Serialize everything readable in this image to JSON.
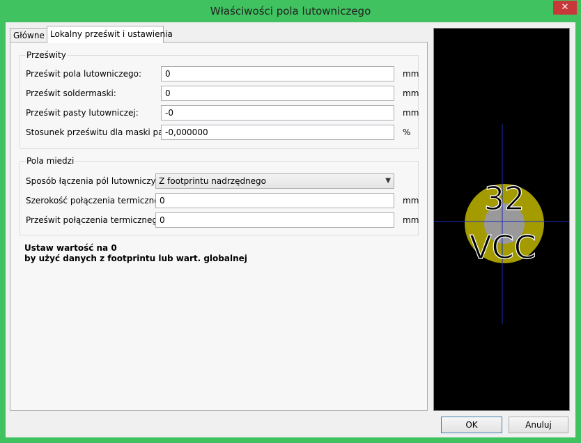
{
  "window": {
    "title": "Właściwości pola lutowniczego",
    "close_symbol": "✕"
  },
  "tabs": [
    {
      "label": "Główne"
    },
    {
      "label": "Lokalny prześwit i ustawienia"
    }
  ],
  "clearances": {
    "title": "Prześwity",
    "pad_clearance": {
      "label": "Prześwit pola lutowniczego:",
      "value": "0",
      "unit": "mm"
    },
    "soldermask_clearance": {
      "label": "Prześwit soldermaski:",
      "value": "0",
      "unit": "mm"
    },
    "paste_clearance": {
      "label": "Prześwit pasty lutowniczej:",
      "value": "-0",
      "unit": "mm"
    },
    "paste_ratio": {
      "label": "Stosunek prześwitu dla maski pasty:",
      "value": "-0,000000",
      "unit": "%"
    }
  },
  "copper_zones": {
    "title": "Pola miedzi",
    "connection": {
      "label": "Sposób łączenia pól lutowniczych:",
      "value": "Z footprintu nadrzędnego"
    },
    "thermal_width": {
      "label": "Szerokość połączenia termicznego",
      "value": "0",
      "unit": "mm"
    },
    "thermal_gap": {
      "label": "Prześwit połączenia termicznego:",
      "value": "0",
      "unit": "mm"
    }
  },
  "note": {
    "line1": "Ustaw wartość na 0",
    "line2": "by użyć danych z footprintu lub wart. globalnej"
  },
  "preview": {
    "pad_number": "32",
    "net_name": "VCC",
    "pad_color": "#a39b00",
    "hole_color": "#999999",
    "crosshair_color": "#1a2bc0"
  },
  "buttons": {
    "ok": "OK",
    "cancel": "Anuluj"
  }
}
